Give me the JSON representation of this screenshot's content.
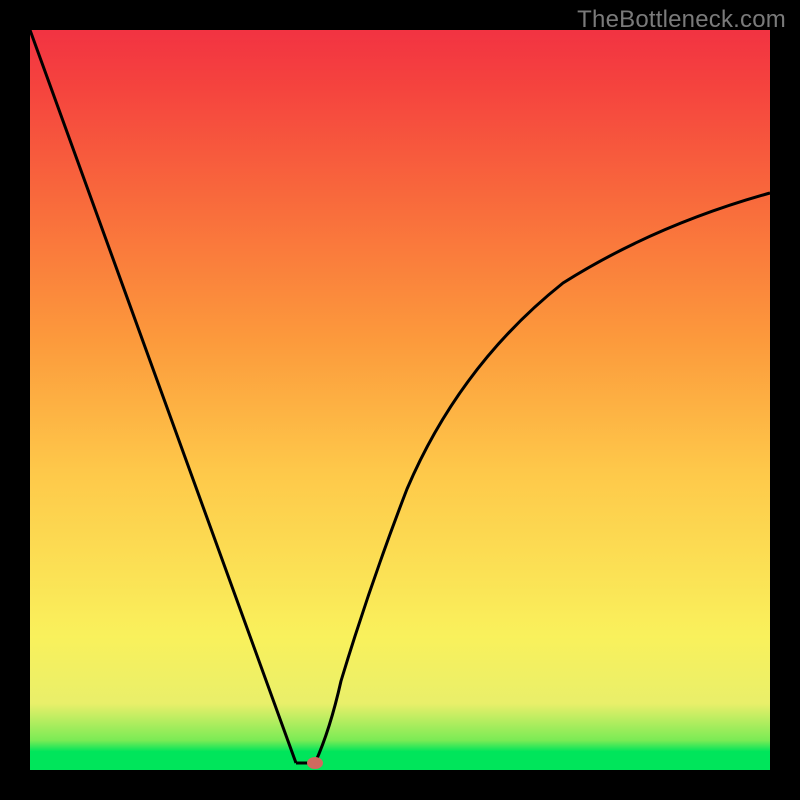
{
  "watermark": "TheBottleneck.com",
  "colors": {
    "frame": "#000000",
    "gradient_top": "#f23342",
    "gradient_bottom": "#00e55b",
    "curve": "#000000",
    "marker": "#cf6a5f"
  },
  "chart_data": {
    "type": "line",
    "title": "",
    "xlabel": "",
    "ylabel": "",
    "xlim": [
      0,
      100
    ],
    "ylim": [
      0,
      100
    ],
    "background_gradient": "green-bottom→yellow→orange→red-top",
    "series": [
      {
        "name": "left-descent",
        "x": [
          0,
          6,
          12,
          18,
          24,
          29,
          33,
          36
        ],
        "values": [
          100,
          83,
          67,
          50,
          33,
          17,
          3,
          0
        ]
      },
      {
        "name": "valley-floor",
        "x": [
          36,
          38.5
        ],
        "values": [
          0,
          0
        ]
      },
      {
        "name": "right-ascent",
        "x": [
          38.5,
          42,
          46,
          51,
          57,
          64,
          72,
          81,
          90,
          100
        ],
        "values": [
          0,
          12,
          25,
          38,
          50,
          59,
          66,
          71,
          75,
          78
        ]
      }
    ],
    "marker": {
      "x": 38.5,
      "y": 0,
      "shape": "ellipse"
    },
    "notes": "Axes have no ticks or labels; plot sits inside a black frame."
  }
}
